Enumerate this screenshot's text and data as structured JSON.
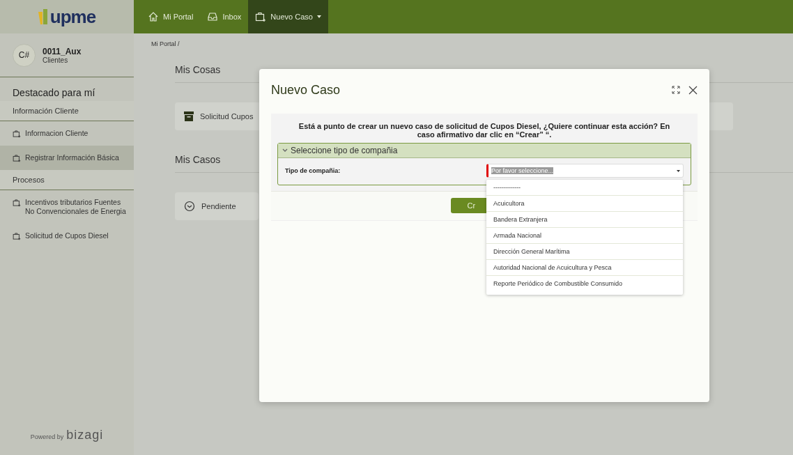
{
  "sidebar": {
    "logo": "upme",
    "user": {
      "initials": "C#",
      "name": "0011_Aux",
      "role": "Clientes"
    },
    "sections": [
      {
        "title": "Destacado para mí",
        "subtitle": "Información Cliente",
        "items": [
          {
            "label": "Informacion Cliente",
            "selected": false
          },
          {
            "label": "Registrar Información Básica",
            "selected": true
          }
        ]
      },
      {
        "subtitle": "Procesos",
        "items": [
          {
            "label": "Incentivos tributarios Fuentes No Convencionales de Energia",
            "selected": false
          },
          {
            "label": "Solicitud de Cupos Diesel",
            "selected": false
          }
        ]
      }
    ],
    "footer": {
      "prefix": "Powered by",
      "brand": "bizagi"
    }
  },
  "topbar": {
    "tabs": [
      {
        "label": "Mi Portal",
        "kind": "home",
        "selected": false
      },
      {
        "label": "Inbox",
        "kind": "inbox",
        "selected": false
      },
      {
        "label": "Nuevo Caso",
        "kind": "case",
        "selected": true
      }
    ]
  },
  "breadcrumb": "Mi Portal /",
  "main": {
    "sections": [
      {
        "title": "Mis Cosas",
        "card": {
          "kind": "archive",
          "label": "Solicitud Cupos"
        }
      },
      {
        "title": "Mis Casos",
        "card": {
          "kind": "clock",
          "label": "Pendiente"
        }
      }
    ]
  },
  "modal": {
    "title": "Nuevo Caso",
    "message": "Está a punto de crear un nuevo caso de solicitud de Cupos Diesel, ¿Quiere continuar esta acción? En caso afirmativo dar clic en “Crear” “.",
    "group": {
      "title": "Seleccione tipo de compañia",
      "expanded": true,
      "field": {
        "label": "Tipo de compañia:",
        "placeholder": "Por favor seleccione...",
        "required": true,
        "options": [
          "-------------",
          "Acuicultora",
          "Bandera Extranjera",
          "Armada Nacional",
          "Dirección General Marítima",
          "Autoridad Nacional de Acuicultura y Pesca",
          "Reporte Periódico de Combustible Consumido"
        ]
      }
    },
    "button": "Cr"
  }
}
